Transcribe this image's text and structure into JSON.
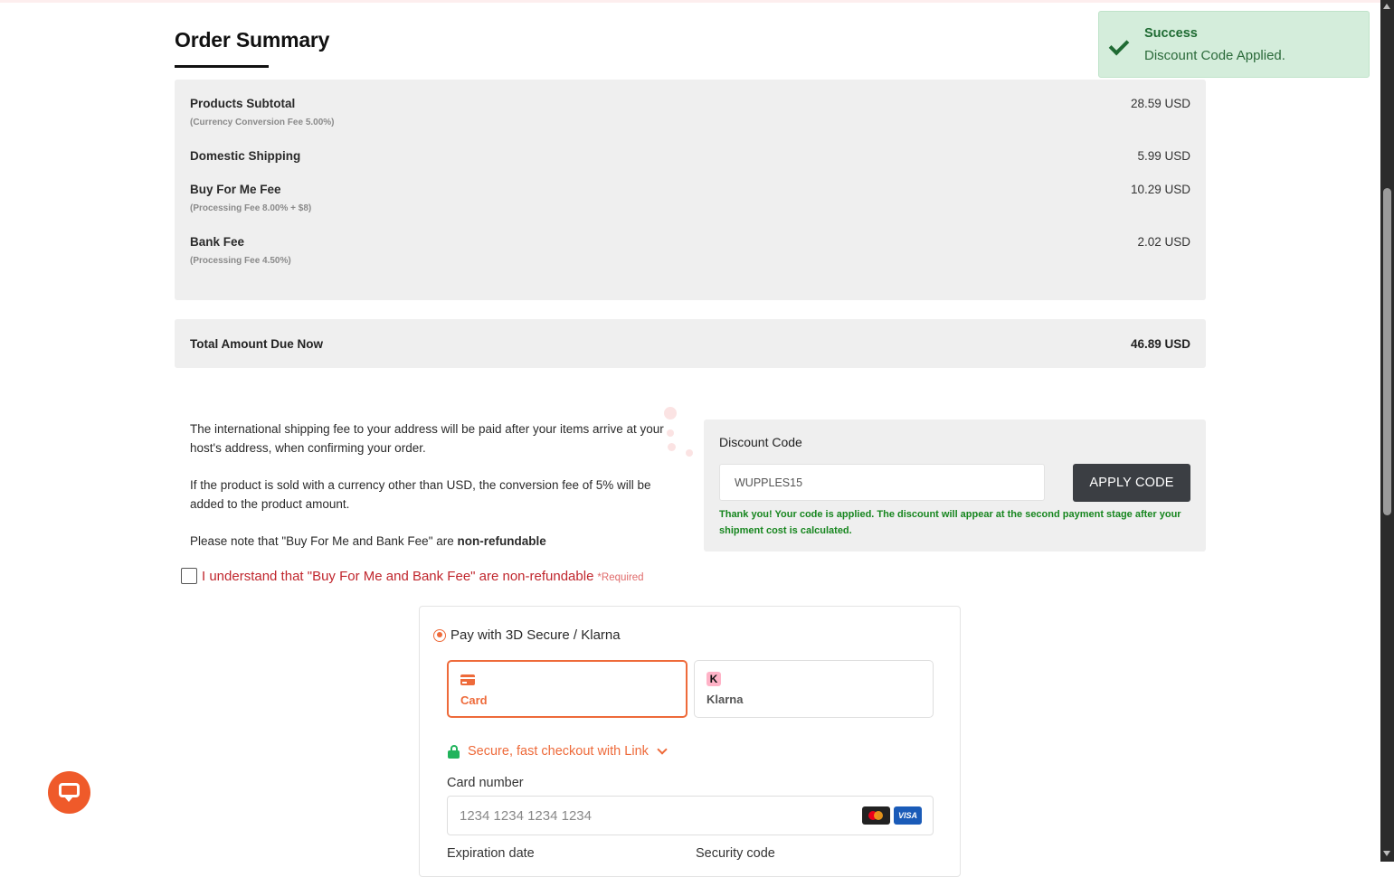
{
  "page": {
    "title": "Order Summary"
  },
  "summary": {
    "rows": [
      {
        "label": "Products Subtotal",
        "sub": "(Currency Conversion Fee 5.00%)",
        "value": "28.59 USD"
      },
      {
        "label": "Domestic Shipping",
        "sub": "",
        "value": "5.99 USD"
      },
      {
        "label": "Buy For Me Fee",
        "sub": "(Processing Fee 8.00% + $8)",
        "value": "10.29 USD"
      },
      {
        "label": "Bank Fee",
        "sub": "(Processing Fee 4.50%)",
        "value": "2.02 USD"
      }
    ],
    "total_label": "Total Amount Due Now",
    "total_value": "46.89 USD"
  },
  "notes": {
    "line1": "The international shipping fee to your address will be paid after your items arrive at your host's address, when confirming your order.",
    "line2": "If the product is sold with a currency other than USD, the conversion fee of 5% will be added to the product amount.",
    "line3_prefix": "Please note that \"Buy For Me and Bank Fee\" are ",
    "line3_bold": "non-refundable"
  },
  "discount": {
    "label": "Discount Code",
    "value": "WUPPLES15",
    "button": "APPLY CODE",
    "message": "Thank you! Your code is applied. The discount will appear at the second payment stage after your shipment cost is calculated."
  },
  "agreement": {
    "text": "I understand that \"Buy For Me and Bank Fee\" are non-refundable",
    "required": "*Required",
    "checked": false
  },
  "payment": {
    "option_label": "Pay with 3D Secure / Klarna",
    "methods": [
      {
        "label": "Card",
        "icon": "credit-card-icon",
        "selected": true
      },
      {
        "label": "Klarna",
        "icon": "klarna-icon",
        "selected": false
      }
    ],
    "link_text": "Secure, fast checkout with Link",
    "card_number_label": "Card number",
    "card_number_placeholder": "1234 1234 1234 1234",
    "expiration_label": "Expiration date",
    "security_label": "Security code",
    "brand_visa": "VISA"
  },
  "toast": {
    "title": "Success",
    "message": "Discount Code Applied."
  },
  "colors": {
    "accent": "#ee6a3a",
    "success": "#17861f",
    "error": "#c0262d",
    "button_dark": "#3b3e43"
  }
}
